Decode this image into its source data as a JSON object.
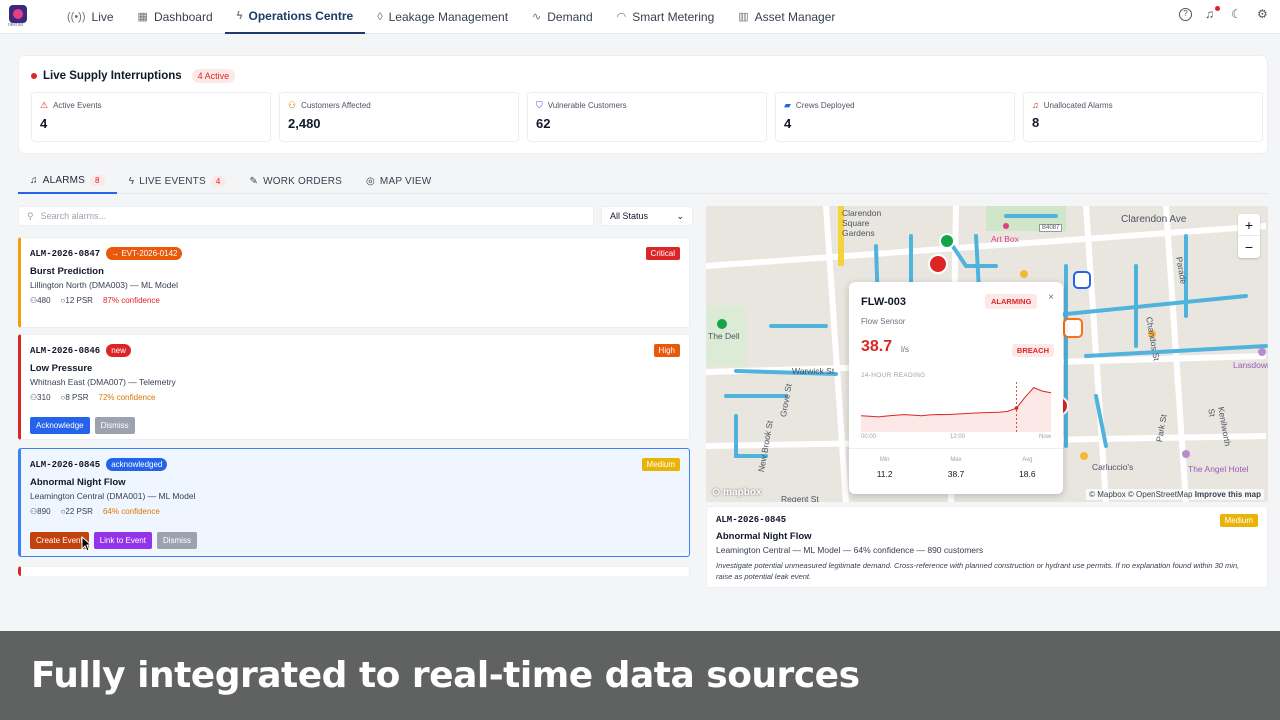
{
  "app": {
    "logo_text": "okeralt"
  },
  "nav": {
    "items": [
      {
        "label": "Live",
        "icon": "signal-icon"
      },
      {
        "label": "Dashboard",
        "icon": "grid-icon"
      },
      {
        "label": "Operations Centre",
        "icon": "bolt-icon",
        "active": true
      },
      {
        "label": "Leakage Management",
        "icon": "droplet-icon"
      },
      {
        "label": "Demand",
        "icon": "pulse-icon"
      },
      {
        "label": "Smart Metering",
        "icon": "gauge-icon"
      },
      {
        "label": "Asset Manager",
        "icon": "building-icon"
      }
    ]
  },
  "summary": {
    "title": "Live Supply Interruptions",
    "active_badge": "4 Active",
    "stats": [
      {
        "label": "Active Events",
        "value": "4",
        "color": "#dc2626"
      },
      {
        "label": "Customers Affected",
        "value": "2,480",
        "color": "#d97706"
      },
      {
        "label": "Vulnerable Customers",
        "value": "62",
        "color": "#7c3aed"
      },
      {
        "label": "Crews Deployed",
        "value": "4",
        "color": "#2563eb"
      },
      {
        "label": "Unallocated Alarms",
        "value": "8",
        "color": "#dc2626"
      }
    ]
  },
  "tabs": [
    {
      "label": "ALARMS",
      "count": "8",
      "active": true
    },
    {
      "label": "LIVE EVENTS",
      "count": "4"
    },
    {
      "label": "WORK ORDERS"
    },
    {
      "label": "MAP VIEW"
    }
  ],
  "search": {
    "placeholder": "Search alarms..."
  },
  "status_filter": {
    "value": "All Status"
  },
  "alarms": [
    {
      "id": "ALM-2026-0847",
      "tag": "→ EVT-2026-0142",
      "severity": "Critical",
      "title": "Burst Prediction",
      "subtitle": "Lillington North (DMA003) — ML Model",
      "customers": "480",
      "psr": "12 PSR",
      "confidence": "87% confidence"
    },
    {
      "id": "ALM-2026-0846",
      "tag": "new",
      "severity": "High",
      "title": "Low Pressure",
      "subtitle": "Whitnash East (DMA007) — Telemetry",
      "customers": "310",
      "psr": "8 PSR",
      "confidence": "72% confidence",
      "actions": [
        "Acknowledge",
        "Dismiss"
      ]
    },
    {
      "id": "ALM-2026-0845",
      "tag": "acknowledged",
      "severity": "Medium",
      "title": "Abnormal Night Flow",
      "subtitle": "Leamington Central (DMA001) — ML Model",
      "customers": "890",
      "psr": "22 PSR",
      "confidence": "64% confidence",
      "actions": [
        "Create Event",
        "Link to Event",
        "Dismiss"
      ]
    }
  ],
  "map": {
    "labels": [
      "Clarendon Square Gardens",
      "Clarendon Ave",
      "Art Box",
      "The Dell",
      "Warwick St",
      "Grove St",
      "New Brook St",
      "Regent St",
      "Chandos St",
      "Parade",
      "Park St",
      "Kenilworth St",
      "Lansdowne",
      "Carluccio's",
      "The Angel Hotel",
      "B4087"
    ],
    "mapbox_logo": "mapbox",
    "attribution": "© Mapbox © OpenStreetMap",
    "improve": "Improve this map",
    "zoom_in": "+",
    "zoom_out": "−"
  },
  "popup": {
    "id": "FLW-003",
    "status": "ALARMING",
    "close": "×",
    "type": "Flow Sensor",
    "value": "38.7",
    "unit": "l/s",
    "breach": "BREACH",
    "chart_label": "24-HOUR READING",
    "x_ticks": [
      "00:00",
      "12:00",
      "Now"
    ],
    "series": [
      13,
      12.5,
      12,
      12.8,
      13.5,
      14,
      13.6,
      13,
      13.8,
      14.2,
      14,
      14.5,
      15,
      15.4,
      15.8,
      16,
      16.2,
      17,
      20,
      30,
      38.7,
      35.5,
      34
    ],
    "min_label": "Min",
    "min": "11.2",
    "max_label": "Max",
    "max": "38.7",
    "avg_label": "Avg",
    "avg": "18.6"
  },
  "detail": {
    "id": "ALM-2026-0845",
    "severity": "Medium",
    "title": "Abnormal Night Flow",
    "subtitle": "Leamington Central — ML Model — 64% confidence — 890 customers",
    "note": "Investigate potential unmeasured legitimate demand. Cross-reference with planned construction or hydrant use permits. If no explanation found within 30 min, raise as potential leak event."
  },
  "caption": "Fully integrated to real-time data sources"
}
